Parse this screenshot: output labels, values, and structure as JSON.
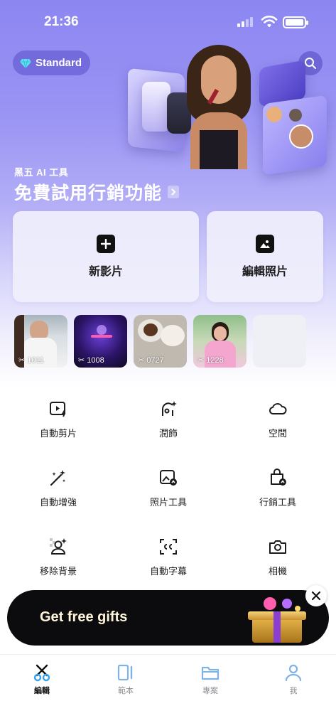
{
  "status_bar": {
    "time": "21:36"
  },
  "header": {
    "plan_label": "Standard"
  },
  "hero": {
    "subtitle": "黑五 AI 工具",
    "title": "免費試用行銷功能"
  },
  "actions": {
    "new_video": "新影片",
    "edit_photo": "編輯照片"
  },
  "recent_projects": [
    {
      "duration": "1011"
    },
    {
      "duration": "1008"
    },
    {
      "duration": "0727"
    },
    {
      "duration": "1228"
    }
  ],
  "tools": [
    {
      "label": "自動剪片",
      "icon": "auto-cut-icon"
    },
    {
      "label": "潤飾",
      "icon": "retouch-icon"
    },
    {
      "label": "空間",
      "icon": "cloud-icon"
    },
    {
      "label": "自動增強",
      "icon": "magic-wand-icon"
    },
    {
      "label": "照片工具",
      "icon": "photo-tools-icon"
    },
    {
      "label": "行銷工具",
      "icon": "marketing-bag-icon"
    },
    {
      "label": "移除背景",
      "icon": "remove-background-icon"
    },
    {
      "label": "自動字幕",
      "icon": "captions-icon"
    },
    {
      "label": "相機",
      "icon": "camera-icon"
    }
  ],
  "promo": {
    "text": "Get free gifts"
  },
  "tabbar": [
    {
      "label": "編輯",
      "icon": "scissors-icon",
      "active": true
    },
    {
      "label": "範本",
      "icon": "template-icon",
      "active": false
    },
    {
      "label": "專案",
      "icon": "folder-icon",
      "active": false
    },
    {
      "label": "我",
      "icon": "profile-icon",
      "active": false
    }
  ],
  "colors": {
    "accent": "#8c86f2",
    "promo_bg": "#0c0c0e",
    "active_tab": "#111111",
    "inactive_tab": "#8e8e93",
    "tab_icon_blue": "#7fb2e6"
  }
}
